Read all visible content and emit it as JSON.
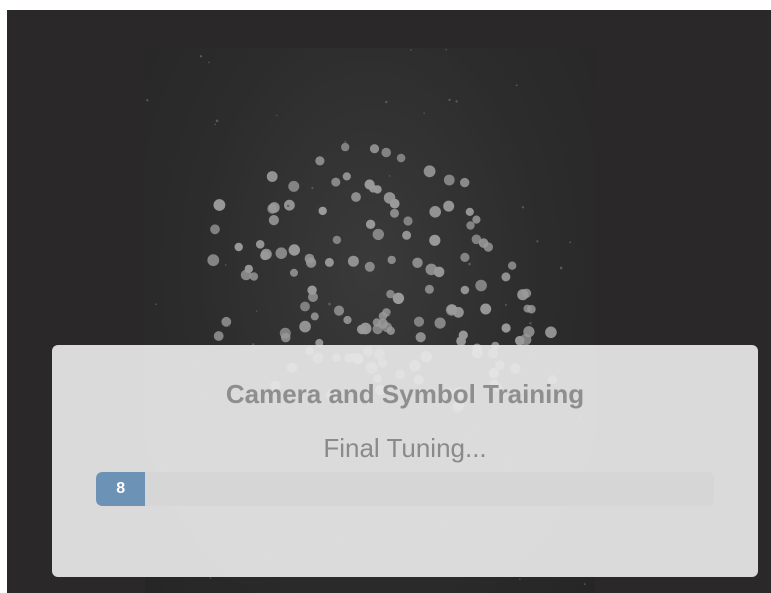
{
  "dialog": {
    "title": "Camera and Symbol Training",
    "status": "Final Tuning...",
    "progress": {
      "value_percent": 8,
      "label": "8"
    }
  },
  "camera_view": {
    "subject": "dot pattern under camera"
  },
  "colors": {
    "viewport_bg": "#2a2829",
    "progress_fill": "#6c93b5",
    "progress_track": "#d6d6d6"
  }
}
